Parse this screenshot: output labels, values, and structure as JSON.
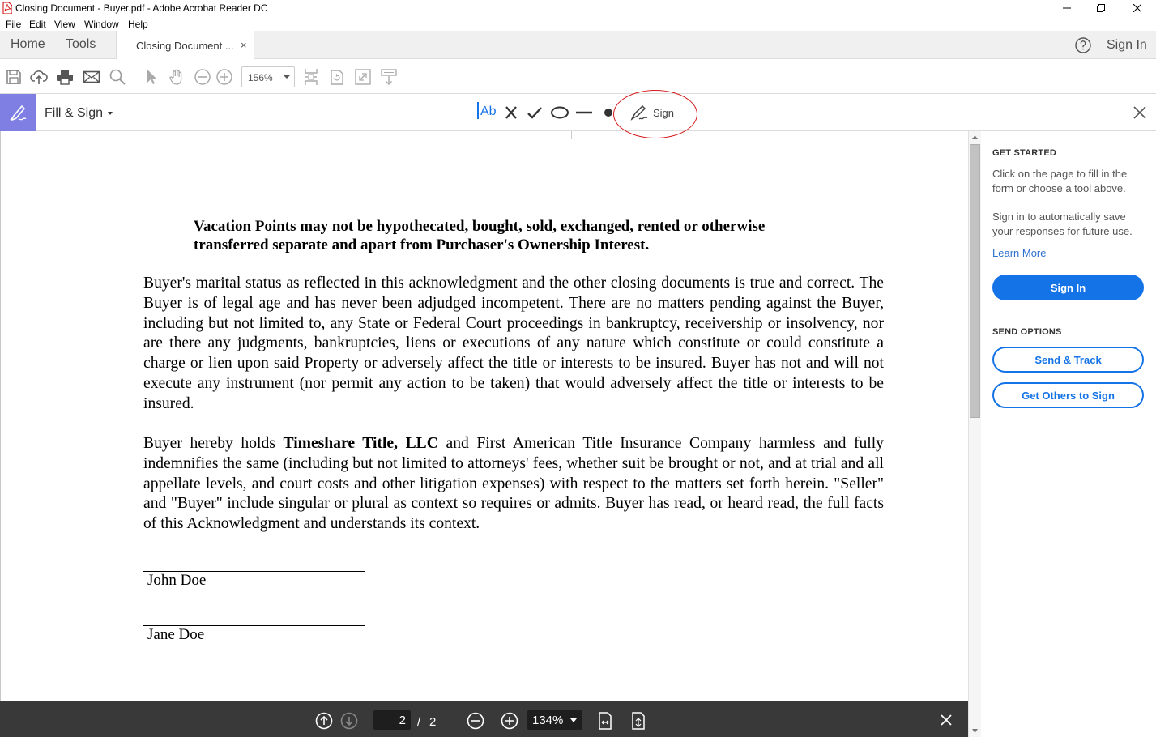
{
  "window": {
    "title": "Closing Document - Buyer.pdf - Adobe Acrobat Reader DC",
    "controls": [
      "minimize",
      "restore",
      "close"
    ]
  },
  "menu": [
    "File",
    "Edit",
    "View",
    "Window",
    "Help"
  ],
  "tabs": {
    "home": "Home",
    "tools": "Tools",
    "document": "Closing Document ...",
    "document_close": "×",
    "sign_in": "Sign In"
  },
  "toolbar": {
    "zoom": "156%",
    "icons": [
      "save-icon",
      "upload-cloud-icon",
      "print-icon",
      "email-icon",
      "search-icon",
      "select-cursor-icon",
      "hand-icon",
      "zoom-out-icon",
      "zoom-in-icon",
      "fit-page-icon",
      "rotate-icon",
      "full-screen-icon",
      "scroll-mode-icon"
    ]
  },
  "fill_sign": {
    "label": "Fill & Sign",
    "tools": [
      "text-ab-icon",
      "cross-icon",
      "check-icon",
      "ellipse-icon",
      "line-icon",
      "dot-icon",
      "sign-pen-icon"
    ],
    "text_tool_label": "Ab",
    "sign_label": "Sign",
    "accent": "#7f7fe3",
    "annotation_color": "#d51a1a"
  },
  "document": {
    "heading": "Vacation Points may not be hypothecated, bought, sold, exchanged, rented or otherwise transferred separate and apart from Purchaser's Ownership Interest.",
    "para1": "Buyer's marital status as reflected in this acknowledgment and the other closing documents is true and correct. The Buyer is of legal age and has never been adjudged incompetent. There are no matters pending against the Buyer, including but not limited to, any State or Federal Court proceedings in bankruptcy, receivership or insolvency, nor are there any judgments, bankruptcies, liens or executions of any nature which constitute or could constitute a charge or lien upon said Property or adversely affect the title or interests to be insured. Buyer has not and will not execute any instrument (nor permit any action to be taken) that would adversely affect the title or interests to be insured.",
    "para2_before": "Buyer hereby holds ",
    "para2_bold": "Timeshare Title, LLC",
    "para2_after": " and First American Title Insurance Company harmless and fully indemnifies the same (including but not limited to attorneys' fees, whether suit be brought or not, and at trial and all appellate levels, and court costs and other litigation expenses) with respect to the matters set forth herein. \"Seller\" and \"Buyer\" include singular or plural as context so requires or admits. Buyer has read, or heard read, the full facts of this Acknowledgment and understands its context.",
    "signer1": "John Doe",
    "signer2": "Jane Doe"
  },
  "bottom_bar": {
    "current_page": "2",
    "separator": "/",
    "total_pages": "2",
    "zoom": "134%"
  },
  "right_panel": {
    "get_started_heading": "GET STARTED",
    "get_started_text": "Click on the page to fill in the form or choose a tool above.",
    "sign_in_text": "Sign in to automatically save your responses for future use.",
    "learn_more": "Learn More",
    "sign_in_button": "Sign In",
    "send_options_heading": "SEND OPTIONS",
    "send_track_button": "Send & Track",
    "get_others_button": "Get Others to Sign",
    "accent": "#1473e6"
  }
}
